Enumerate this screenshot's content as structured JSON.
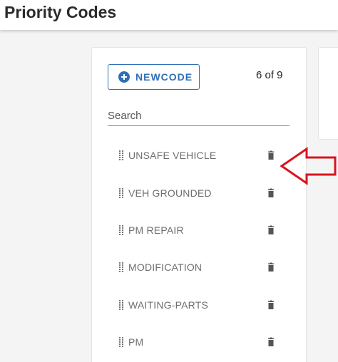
{
  "header": {
    "title": "Priority Codes"
  },
  "toolbar": {
    "new_code_label": "NEWCODE",
    "count_text": "6 of 9"
  },
  "search": {
    "placeholder": "Search",
    "value": ""
  },
  "codes": [
    {
      "label": "UNSAFE VEHICLE"
    },
    {
      "label": "VEH GROUNDED"
    },
    {
      "label": "PM REPAIR"
    },
    {
      "label": "MODIFICATION"
    },
    {
      "label": "WAITING-PARTS"
    },
    {
      "label": "PM"
    }
  ],
  "colors": {
    "accent": "#2f6fb6",
    "annotation": "#d9141e",
    "icon": "#555555",
    "item_text": "#6e6e6e"
  }
}
